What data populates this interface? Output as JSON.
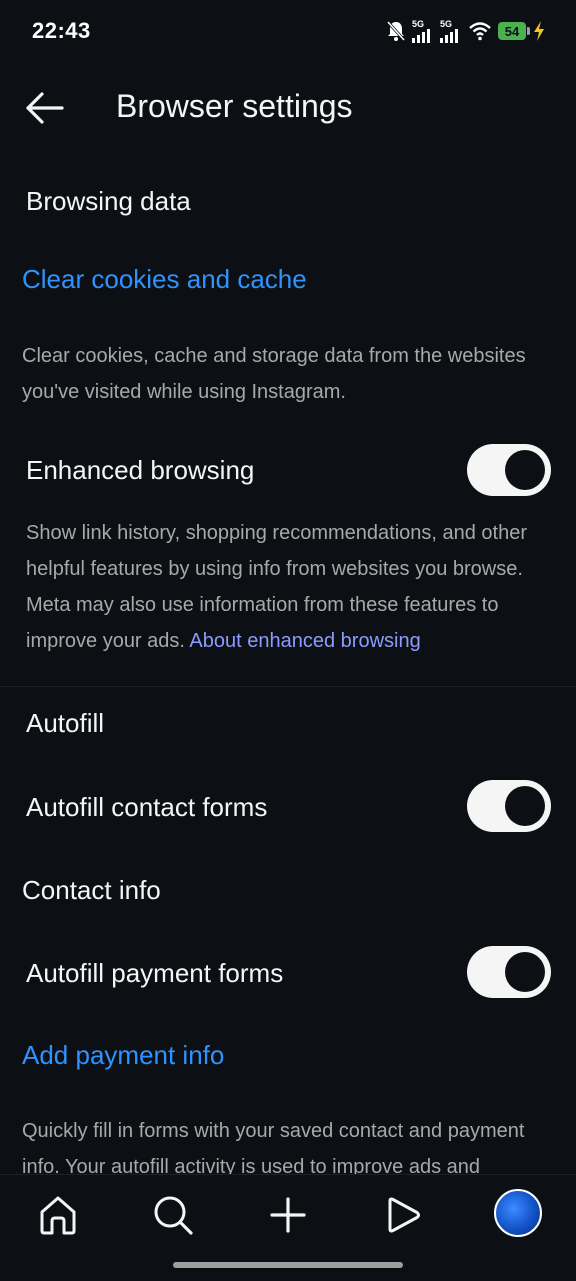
{
  "status_bar": {
    "time": "22:43",
    "network_1": "5G",
    "network_2": "5G",
    "battery": "54"
  },
  "header": {
    "title": "Browser settings"
  },
  "browsing_data": {
    "title": "Browsing data",
    "clear_link": "Clear cookies and cache",
    "clear_desc": "Clear cookies, cache and storage data from the websites you've visited while using Instagram."
  },
  "enhanced": {
    "label": "Enhanced browsing",
    "enabled": true,
    "desc": "Show link history, shopping recommendations, and other helpful features by using info from websites you browse. Meta may also use information from these features to improve your ads. ",
    "about_link": "About enhanced browsing"
  },
  "autofill": {
    "title": "Autofill",
    "contact_label": "Autofill contact forms",
    "contact_enabled": true,
    "contact_info_label": "Contact info",
    "payment_label": "Autofill payment forms",
    "payment_enabled": true,
    "add_payment_link": "Add payment info",
    "desc": "Quickly fill in forms with your saved contact and payment info. Your autofill activity is used to improve ads and"
  },
  "bottom_nav": {
    "items": [
      "home-icon",
      "search-icon",
      "create-icon",
      "reels-icon",
      "profile-avatar"
    ]
  }
}
